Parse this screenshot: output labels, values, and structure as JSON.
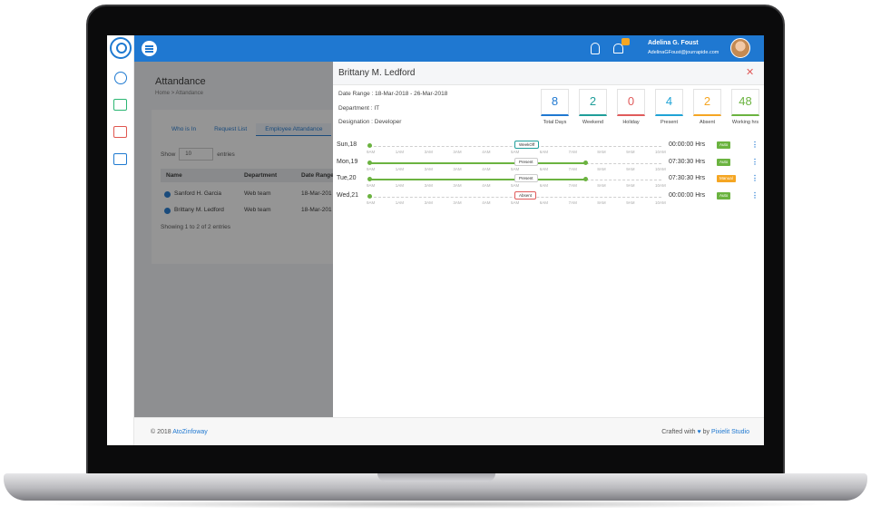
{
  "topbar": {
    "user_name": "Adelina G. Foust",
    "user_email": "AdelinaGFoust@jourrapide.com"
  },
  "page": {
    "title": "Attandance",
    "breadcrumb_home": "Home",
    "breadcrumb_sep": ">",
    "breadcrumb_current": "Attandance"
  },
  "tabs": [
    "Who is In",
    "Request List",
    "Employee Attandance"
  ],
  "table": {
    "show_label": "Show",
    "entries_value": "10",
    "entries_label": "entries",
    "headers": [
      "Name",
      "Department",
      "Date Range"
    ],
    "rows": [
      {
        "name": "Sanford H. Garcia",
        "department": "Web team",
        "date": "18-Mar-201"
      },
      {
        "name": "Brittany M. Ledford",
        "department": "Web team",
        "date": "18-Mar-201"
      }
    ],
    "info": "Showing 1 to 2 of 2 entries"
  },
  "panel": {
    "title": "Brittany M. Ledford",
    "date_range": "Date Range : 18-Mar-2018 - 26-Mar-2018",
    "department": "Department : IT",
    "designation": "Designation : Developer",
    "stats": [
      {
        "value": "8",
        "label": "Total Days",
        "color": "#1f78d1"
      },
      {
        "value": "2",
        "label": "Weekend",
        "color": "#1f9e9a"
      },
      {
        "value": "0",
        "label": "Holiday",
        "color": "#e05b5b"
      },
      {
        "value": "4",
        "label": "Present",
        "color": "#1fa3d6"
      },
      {
        "value": "2",
        "label": "Absent",
        "color": "#f5a623"
      },
      {
        "value": "48",
        "label": "Working hrs",
        "color": "#6bb340"
      }
    ],
    "ticks": [
      "9AM",
      "1AM",
      "3AM",
      "3AM",
      "4AM",
      "5AM",
      "6AM",
      "7AM",
      "8AM",
      "9AM",
      "10AM"
    ],
    "timeline": [
      {
        "day": "Sun,18",
        "tag": "WeekOff",
        "hours": "00:00:00 Hrs",
        "badge": "Auto",
        "badge_color": "#6bb340",
        "bar_start": 0,
        "bar_end": 0
      },
      {
        "day": "Mon,19",
        "tag": "Present",
        "hours": "07:30:30 Hrs",
        "badge": "Auto",
        "badge_color": "#6bb340",
        "bar_start": 0,
        "bar_end": 0.74
      },
      {
        "day": "Tue,20",
        "tag": "Present",
        "hours": "07:30:30 Hrs",
        "badge": "Manual",
        "badge_color": "#f5a623",
        "bar_start": 0,
        "bar_end": 0.74
      },
      {
        "day": "Wed,21",
        "tag": "Absent",
        "hours": "00:00:00 Hrs",
        "badge": "Auto",
        "badge_color": "#6bb340",
        "bar_start": 0,
        "bar_end": 0
      }
    ]
  },
  "footer": {
    "copyright": "© 2018",
    "company": "AtoZinfoway",
    "crafted": "Crafted with",
    "by": "by",
    "studio": "Pixielit Studio"
  }
}
